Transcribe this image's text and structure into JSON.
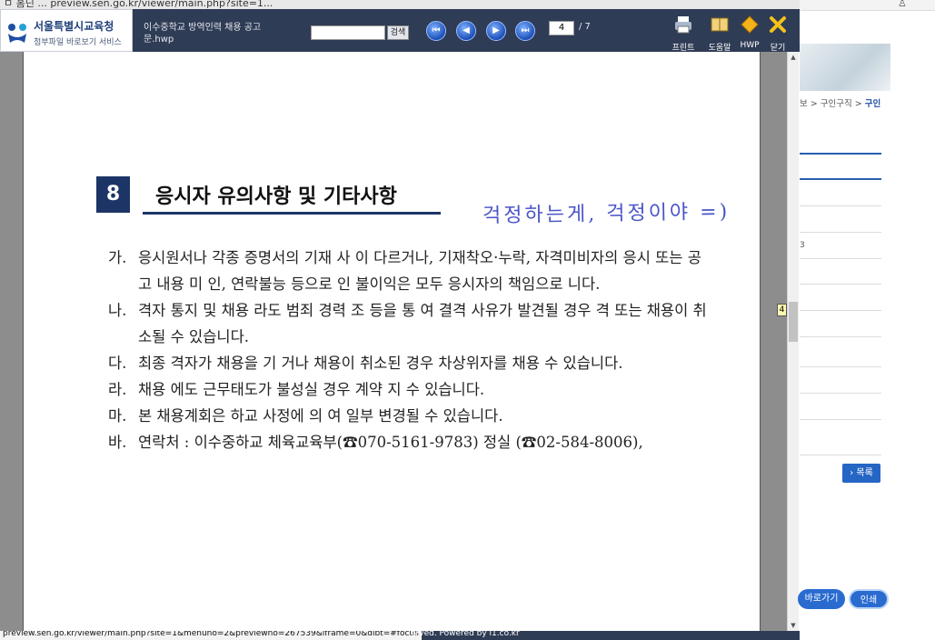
{
  "browser": {
    "top_text": "ㅁ  홈딘 ...  preview.sen.go.kr/viewer/main.php?site=1..."
  },
  "viewer": {
    "brand": {
      "title": "서울특별시교육청",
      "subtitle": "첨부파일 바로보기 서비스"
    },
    "doc_title": "이수중학교 방역인력 채용 공고문.hwp",
    "search": {
      "value": "",
      "button_label": "검색"
    },
    "nav": [
      "first-page",
      "prev-page",
      "next-page",
      "last-page"
    ],
    "page": {
      "current": "4",
      "total": "/ 7"
    },
    "tools": [
      {
        "label": "프린트",
        "icon": "printer-icon"
      },
      {
        "label": "도움말",
        "icon": "help-book-icon"
      },
      {
        "label": "HWP",
        "icon": "hwp-icon"
      },
      {
        "label": "닫기",
        "icon": "close-icon"
      }
    ],
    "colors": {
      "toolbar_bg": "#2f3c55",
      "section_navy": "#1d3566",
      "handwriting": "#4a55c8"
    }
  },
  "document": {
    "section_number": "8",
    "section_title": "응시자 유의사항 및 기타사항",
    "handwritten_note": "걱정하는게, 걱정이야 =)",
    "items": [
      {
        "marker": "가.",
        "text": "응시원서나 각종 증명서의 기재 사  이 다르거나, 기재착오·누락, 자격미비자의 응시 또는 공고 내용 미  인, 연락불능 등으로 인   불이익은 모두 응시자의 책임으로   니다."
      },
      {
        "marker": "나.",
        "text": "  격자 통지 및 채용   라도 범죄 경력 조    등을 통  여 결격 사유가 발견될 경우   격 또는 채용이 취소될 수 있습니다."
      },
      {
        "marker": "다.",
        "text": "최종   격자가 채용을    기  거나 채용이 취소된 경우 차상위자를 채용     수 있습니다."
      },
      {
        "marker": "라.",
        "text": "채용   에도 근무태도가 불성실    경우 계약  지     수 있습니다."
      },
      {
        "marker": "마.",
        "text": "본 채용계회은 하교 사정에 의   여 일부 변경될 수 있습니다."
      },
      {
        "marker": "바.",
        "text": "연락처 : 이수중하교 체육교육부(☎070-5161-9783)     정실 (☎02-584-8006),"
      }
    ]
  },
  "scrollbar": {
    "page_tooltip": "4"
  },
  "status": {
    "url": "preview.sen.go.kr/viewer/main.php?site=1&menuno=2&previewno=267539&iframe=0&dlbt=#focus",
    "powered": "erved. Powered by i1.co.kr"
  },
  "background_page": {
    "breadcrumb_prefix": "보 > 구인구직 > ",
    "breadcrumb_current": "구인",
    "row_number": "3",
    "list_button": "› 목록",
    "go_button": "바로가기",
    "print_button": "인쇄"
  }
}
